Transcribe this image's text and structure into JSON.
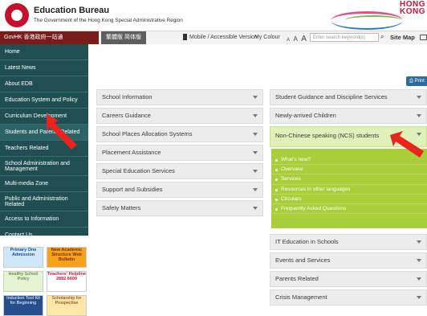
{
  "header": {
    "title": "Education Bureau",
    "subtitle": "The Government of the Hong Kong Special Administrative Region",
    "brand_text_1": "HONG",
    "brand_text_2": "KONG"
  },
  "navstrip": {
    "govhk": "GovHK 香港政府一站通",
    "lang": "繁體版  简体版",
    "mobile": "Mobile / Accessible Version",
    "my_colour": "My Colour",
    "font_sizes": [
      "A",
      "A",
      "A"
    ],
    "search_placeholder": "Enter search keyword(s)",
    "site_map": "Site Map"
  },
  "sidebar": {
    "items": [
      {
        "label": "Home"
      },
      {
        "label": "Latest News"
      },
      {
        "label": "About EDB"
      },
      {
        "label": "Education System and Policy"
      },
      {
        "label": "Curriculum Development"
      },
      {
        "label": "Students and Parents Related"
      },
      {
        "label": "Teachers Related"
      },
      {
        "label": "School Administration and Management"
      },
      {
        "label": "Multi-media Zone"
      },
      {
        "label": "Public and Administration Related"
      },
      {
        "label": "Access to Information"
      },
      {
        "label": "Contact Us"
      }
    ]
  },
  "banners": [
    {
      "text": "Primary One Admission"
    },
    {
      "text": "New Academic Structure Web Bulletin"
    },
    {
      "text": "Healthy School Policy"
    },
    {
      "text": "Teachers' Helpline 2892 6600"
    },
    {
      "text": "Induction Tool Kit for Beginning"
    },
    {
      "text": "Scholarship for Prospective"
    }
  ],
  "print_label": "Print",
  "left_menu": [
    {
      "label": "School Information"
    },
    {
      "label": "Careers Guidance"
    },
    {
      "label": "School Places Allocation Systems"
    },
    {
      "label": "Placement Assistance"
    },
    {
      "label": "Special Education Services"
    },
    {
      "label": "Support and Subsidies"
    },
    {
      "label": "Safety Matters"
    }
  ],
  "right_menu_top": [
    {
      "label": "Student Guidance and Discipline Services"
    },
    {
      "label": "Newly-arrived Children"
    },
    {
      "label": "Non-Chinese speaking (NCS) students"
    }
  ],
  "submenu": [
    {
      "label": "What's new?"
    },
    {
      "label": "Overview"
    },
    {
      "label": "Services"
    },
    {
      "label": "Resources in other languages"
    },
    {
      "label": "Circulars"
    },
    {
      "label": "Frequently Asked Questions"
    }
  ],
  "right_menu_bottom": [
    {
      "label": "IT Education in Schools"
    },
    {
      "label": "Events and Services"
    },
    {
      "label": "Parents Related"
    },
    {
      "label": "Crisis Management"
    }
  ],
  "colors": {
    "sidebar": "#1f4f52",
    "govhk": "#7b1c1c",
    "submenu_green": "#a8cf3a",
    "arrow_red": "#e8241c"
  }
}
